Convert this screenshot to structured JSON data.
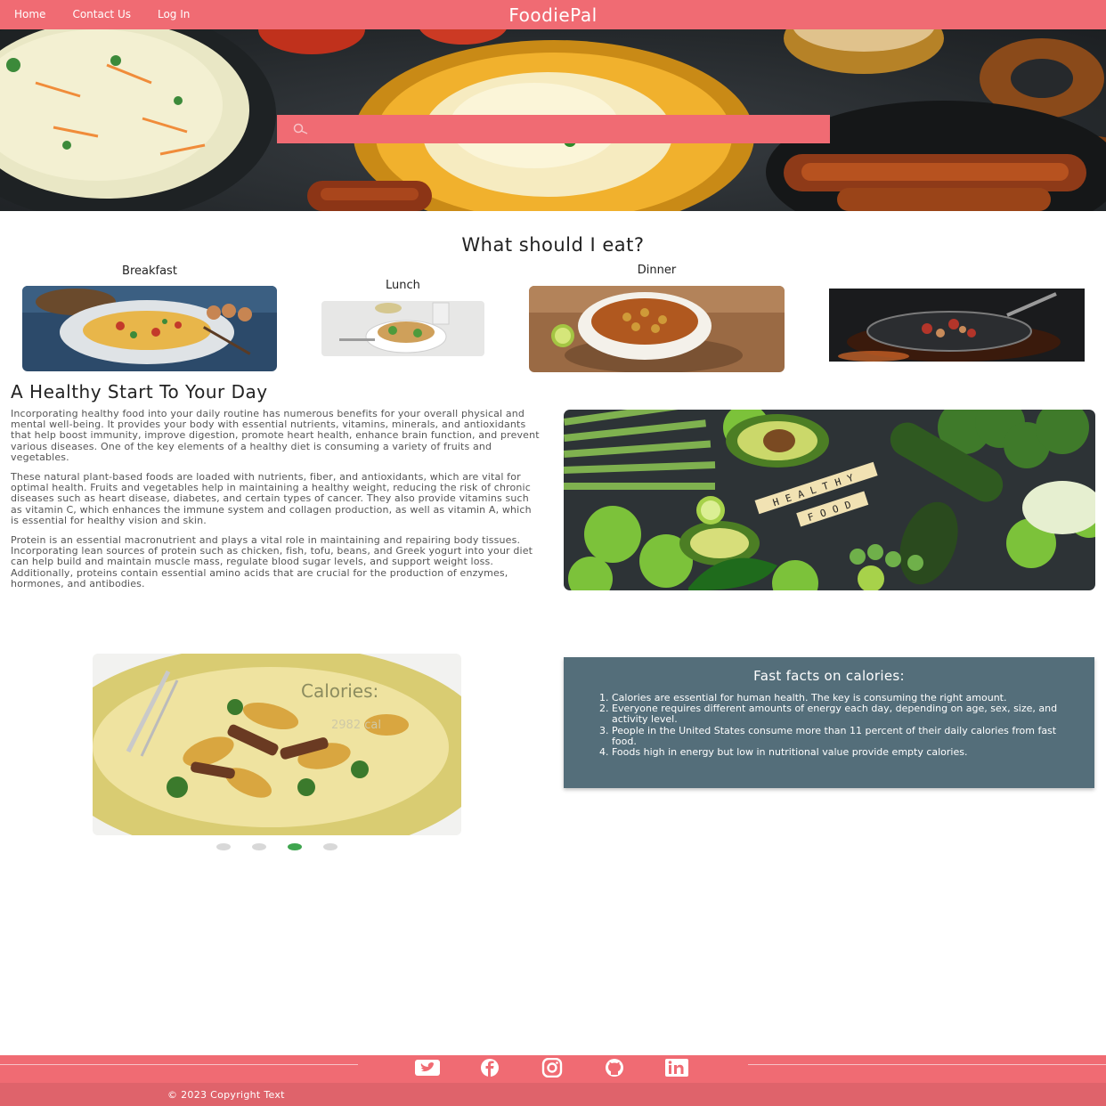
{
  "nav": {
    "links": [
      "Home",
      "Contact Us",
      "Log In"
    ],
    "brand": "FoodiePal"
  },
  "search": {
    "placeholder": "",
    "value": ""
  },
  "meals": {
    "title": "What should I eat?",
    "items": [
      {
        "label": "Breakfast"
      },
      {
        "label": "Lunch"
      },
      {
        "label": "Dinner"
      },
      {
        "label": ""
      }
    ]
  },
  "healthy": {
    "title": "A Healthy Start To Your Day",
    "paragraphs": [
      "Incorporating healthy food into your daily routine has numerous benefits for your overall physical and mental well-being. It provides your body with essential nutrients, vitamins, minerals, and antioxidants that help boost immunity, improve digestion, promote heart health, enhance brain function, and prevent various diseases. One of the key elements of a healthy diet is consuming a variety of fruits and vegetables.",
      "These natural plant-based foods are loaded with nutrients, fiber, and antioxidants, which are vital for optimal health. Fruits and vegetables help in maintaining a healthy weight, reducing the risk of chronic diseases such as heart disease, diabetes, and certain types of cancer. They also provide vitamins such as vitamin C, which enhances the immune system and collagen production, as well as vitamin A, which is essential for healthy vision and skin.",
      "Protein is an essential macronutrient and plays a vital role in maintaining and repairing body tissues. Incorporating lean sources of protein such as chicken, fish, tofu, beans, and Greek yogurt into your diet can help build and maintain muscle mass, regulate blood sugar levels, and support weight loss. Additionally, proteins contain essential amino acids that are crucial for the production of enzymes, hormones, and antibodies."
    ],
    "image_text": [
      "HEALTHY",
      "FOOD"
    ]
  },
  "carousel": {
    "title": "Calories:",
    "value": "2982 cal",
    "dots": 4,
    "active_index": 2
  },
  "facts": {
    "title": "Fast facts on calories:",
    "items": [
      "Calories are essential for human health. The key is consuming the right amount.",
      "Everyone requires different amounts of energy each day, depending on age, sex, size, and activity level.",
      "People in the United States consume more than 11 percent of their daily calories from fast food.",
      "Foods high in energy but low in nutritional value provide empty calories."
    ]
  },
  "footer": {
    "social_icons": [
      "twitter-icon",
      "facebook-icon",
      "instagram-icon",
      "github-icon",
      "linkedin-icon"
    ],
    "copyright": "© 2023 Copyright Text"
  },
  "colors": {
    "primary": "#f06b73",
    "facts_bg": "#546e7a",
    "dot_active": "#3fa54f"
  }
}
